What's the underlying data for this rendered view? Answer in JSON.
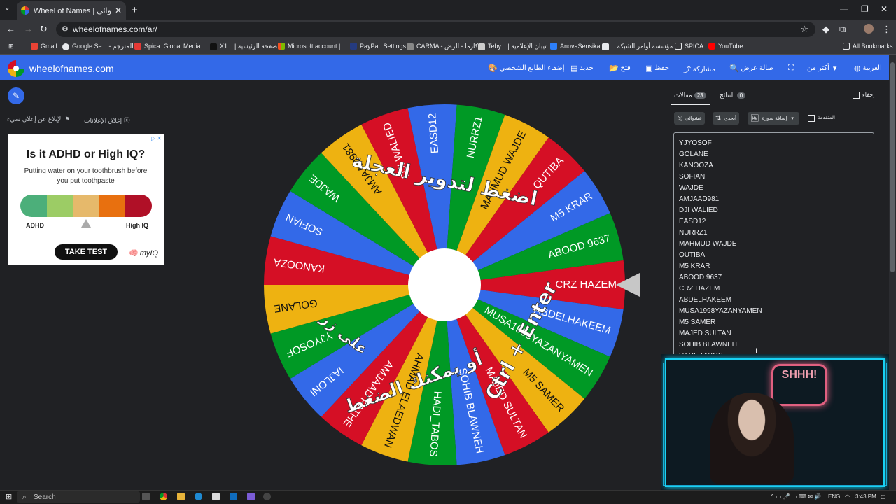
{
  "browser": {
    "tab_title": "Wheel of Names | اسم العشوائي",
    "url": "wheelofnames.com/ar/",
    "bookmarks": [
      "Gmail",
      "Google Se... - المترجم",
      "Spica: Global Media...",
      "X1... | الصفحة الرئيسية",
      "Microsoft account |...",
      "PayPal: Settings",
      "CARMA - كارما - الرض...",
      "Teby... | تيبان الإعلامية",
      "AnovaSensika",
      "...مؤسسة أوامر الشبكة",
      "SPICA",
      "YouTube"
    ],
    "all_bookmarks": "All Bookmarks"
  },
  "app": {
    "brand": "wheelofnames.com",
    "menu": {
      "language": "العربية",
      "more": "أكثر من",
      "fullscreen": "",
      "search": "صالة عرض",
      "share": "مشاركة",
      "save": "حفظ",
      "open": "فتح",
      "new": "جديد",
      "customize": "إضفاء الطابع الشخصي"
    }
  },
  "ads": {
    "report": "الإبلاغ عن إعلان سيء",
    "close": "إغلاق الإعلانات",
    "headline": "Is it ADHD or High IQ?",
    "subtext": "Putting water on your toothbrush before you put toothpaste",
    "label_left": "ADHD",
    "label_right": "High IQ",
    "cta": "TAKE TEST",
    "brand": "myIQ",
    "bar_colors": [
      "#4caf7a",
      "#9ccc65",
      "#e6b96b",
      "#e8700f",
      "#b01027"
    ]
  },
  "wheel": {
    "overlay_top": "اضغط لتدوير العجلة",
    "overlay_bottom_1": "أو يمكنك الضغط",
    "overlay_bottom_2": "على زر",
    "overlay_keys": "Ctrl + Enter",
    "colors": [
      "#d50f25",
      "#3369e8",
      "#009925",
      "#eeb211"
    ],
    "segments": [
      "CRZ HAZEM",
      "ABDELHAKEEM",
      "MUSA1998YAZANYAMEN",
      "M5 SAMER",
      "MAJED SULTAN",
      "SOHIB BLAWNEH",
      "HADI_TABOS",
      "AHMAD ELAEDWAN",
      "AMJAAD FATHE",
      "IAJLONI",
      "YJYOSOF",
      "GOLANE",
      "KANOOZA",
      "SOFIAN",
      "WAJDE",
      "AMJAAD981",
      "DJI WALIED",
      "EASD12",
      "NURRZ1",
      "MAHMUD WAJDE",
      "QUTIBA",
      "M5 KRAR",
      "ABOOD 9637"
    ]
  },
  "panel": {
    "tab_entries": "مقالات",
    "entries_count": "23",
    "tab_results": "النتائج",
    "results_count": "0",
    "hide": "إخفاء",
    "shuffle": "عشوائي",
    "sort": "أبجدي",
    "add_image": "إضافة صورة",
    "advanced": "المتقدمة",
    "entries": [
      "YJYOSOF",
      "GOLANE",
      "KANOOZA",
      "SOFIAN",
      "WAJDE",
      "AMJAAD981",
      "DJI WALIED",
      "EASD12",
      "NURRZ1",
      "MAHMUD WAJDE",
      "QUTIBA",
      "M5 KRAR",
      "ABOOD 9637",
      "CRZ HAZEM",
      "ABDELHAKEEM",
      "MUSA1998YAZANYAMEN",
      "M5 SAMER",
      "MAJED SULTAN",
      "SOHIB BLAWNEH",
      "HADI_TABOS"
    ]
  },
  "webcam": {
    "neon_sign": "SHHH!"
  },
  "taskbar": {
    "search": "Search",
    "lang": "ENG",
    "time": "3:43 PM"
  }
}
